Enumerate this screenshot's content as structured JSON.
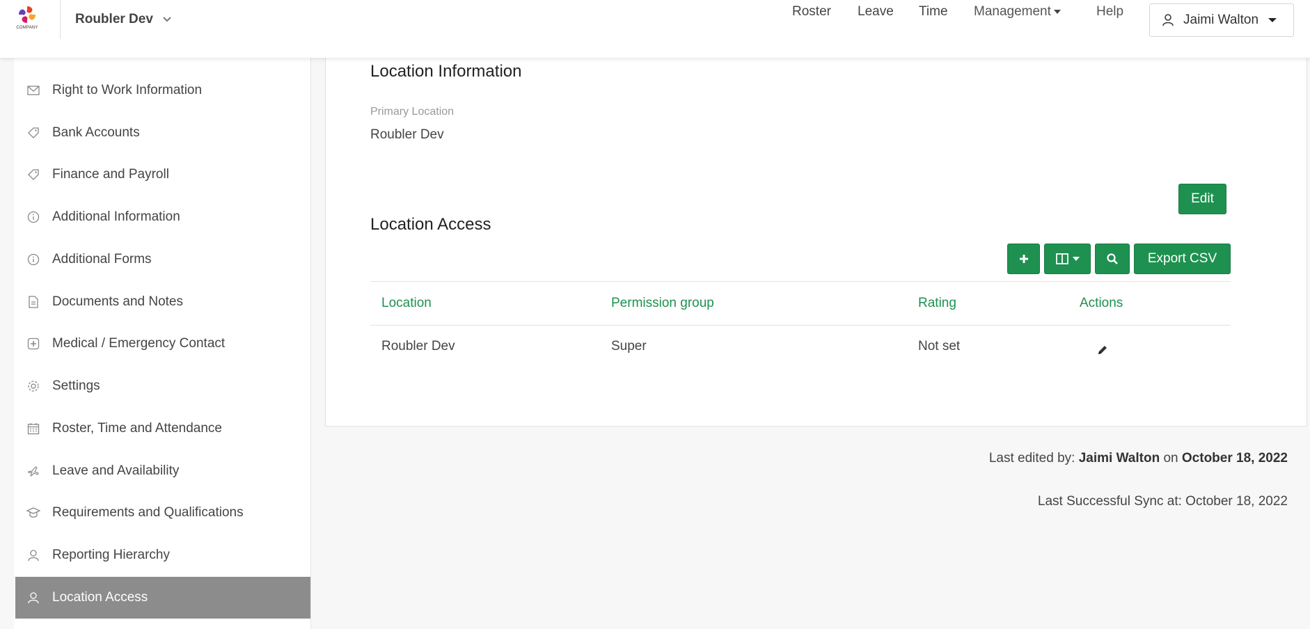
{
  "app": {
    "logo_word": "COMPANY",
    "org_name": "Roubler Dev"
  },
  "nav": {
    "roster": "Roster",
    "leave": "Leave",
    "time": "Time",
    "management": "Management",
    "help": "Help",
    "user_name": "Jaimi Walton"
  },
  "sidebar": {
    "items": [
      {
        "label": "Right to Work Information",
        "icon": "envelope-icon"
      },
      {
        "label": "Bank Accounts",
        "icon": "tag-icon"
      },
      {
        "label": "Finance and Payroll",
        "icon": "tag-icon"
      },
      {
        "label": "Additional Information",
        "icon": "info-icon"
      },
      {
        "label": "Additional Forms",
        "icon": "info-icon"
      },
      {
        "label": "Documents and Notes",
        "icon": "document-icon"
      },
      {
        "label": "Medical / Emergency Contact",
        "icon": "medical-icon"
      },
      {
        "label": "Settings",
        "icon": "gear-icon"
      },
      {
        "label": "Roster, Time and Attendance",
        "icon": "calendar-icon"
      },
      {
        "label": "Leave and Availability",
        "icon": "plane-icon"
      },
      {
        "label": "Requirements and Qualifications",
        "icon": "graduation-icon"
      },
      {
        "label": "Reporting Hierarchy",
        "icon": "user-icon"
      },
      {
        "label": "Location Access",
        "icon": "user-icon",
        "active": true
      }
    ]
  },
  "location_info": {
    "title": "Location Information",
    "primary_label": "Primary Location",
    "primary_value": "Roubler Dev",
    "edit_label": "Edit"
  },
  "location_access": {
    "title": "Location Access",
    "export_label": "Export CSV",
    "columns": [
      "Location",
      "Permission group",
      "Rating",
      "Actions"
    ],
    "rows": [
      {
        "location": "Roubler Dev",
        "permission_group": "Super",
        "rating": "Not set"
      }
    ]
  },
  "footer_meta": {
    "edited_prefix": "Last edited by: ",
    "edited_by": "Jaimi Walton",
    "edited_on_word": " on ",
    "edited_date": "October 18, 2022",
    "sync_text": "Last Successful Sync at: October 18, 2022"
  },
  "colors": {
    "accent_green": "#1e9150",
    "active_sidebar": "#8c8c8c"
  }
}
